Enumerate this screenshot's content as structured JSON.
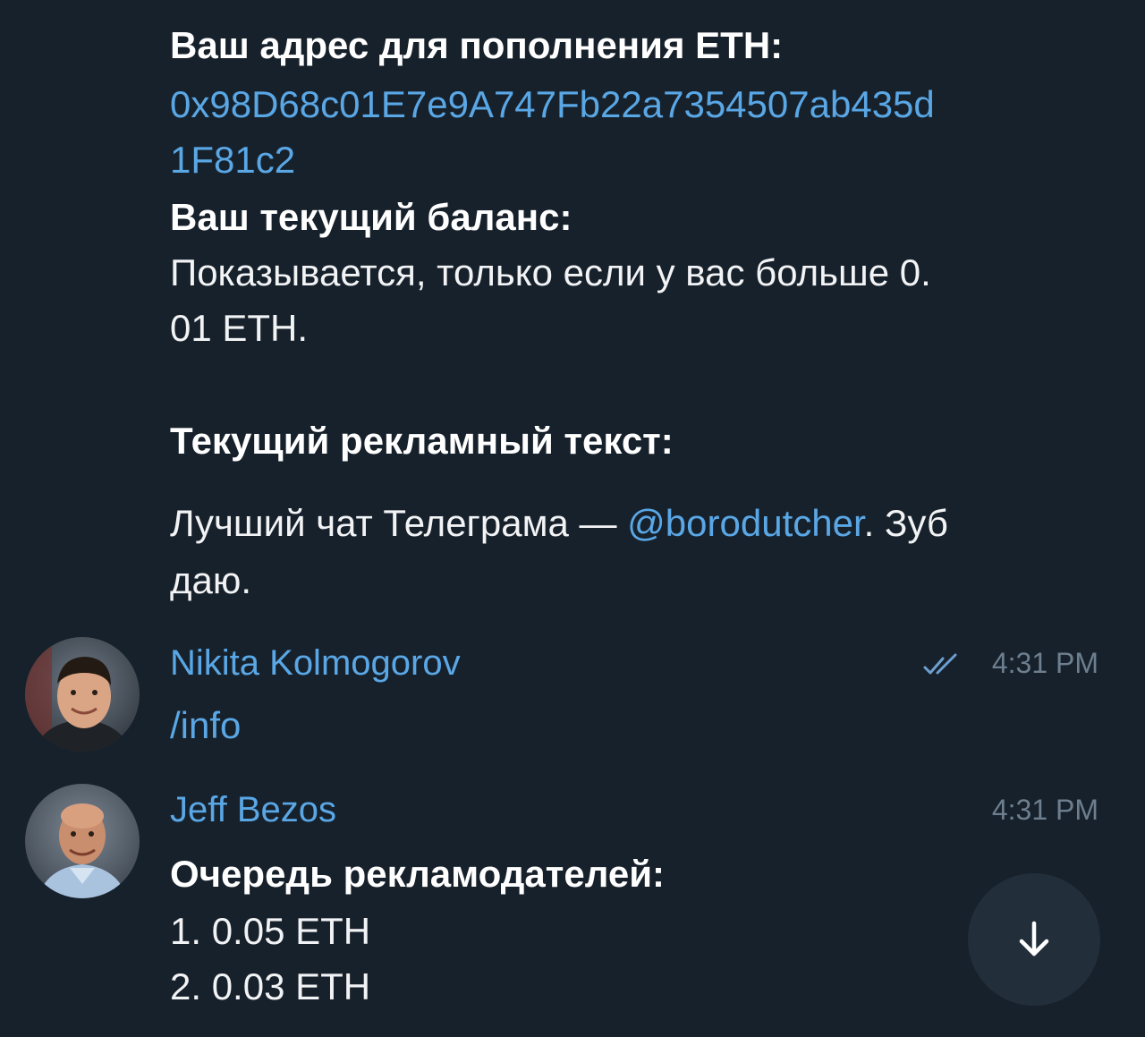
{
  "message1": {
    "address_label": "Ваш адрес для пополнения ETH:",
    "address_line1": "0x98D68c01E7e9A747Fb22a7354507ab435d",
    "address_line2": "1F81c2",
    "balance_label": "Ваш текущий баланс:",
    "balance_line1": "Показывается, только если у вас больше 0.",
    "balance_line2": "01 ETH.",
    "ad_label": "Текущий рекламный текст:",
    "ad_text_prefix": "Лучший чат Телеграма — ",
    "ad_mention": "@borodutcher",
    "ad_text_suffix": ". Зуб",
    "ad_line2": "даю."
  },
  "message2": {
    "sender": "Nikita Kolmogorov",
    "time": "4:31 PM",
    "command": "/info",
    "status": "read",
    "avatar_icon": "avatar-photo"
  },
  "message3": {
    "sender": "Jeff Bezos",
    "time": "4:31 PM",
    "queue_label": "Очередь рекламодателей:",
    "queue_items": [
      "1. 0.05 ETH",
      "2. 0.03 ETH"
    ],
    "avatar_icon": "avatar-photo"
  },
  "scroll_button": {
    "icon": "arrow-down-icon"
  },
  "colors": {
    "background": "#17212b",
    "link": "#5aa7e6",
    "meta": "#6d7f8f",
    "button": "#222f3b"
  }
}
